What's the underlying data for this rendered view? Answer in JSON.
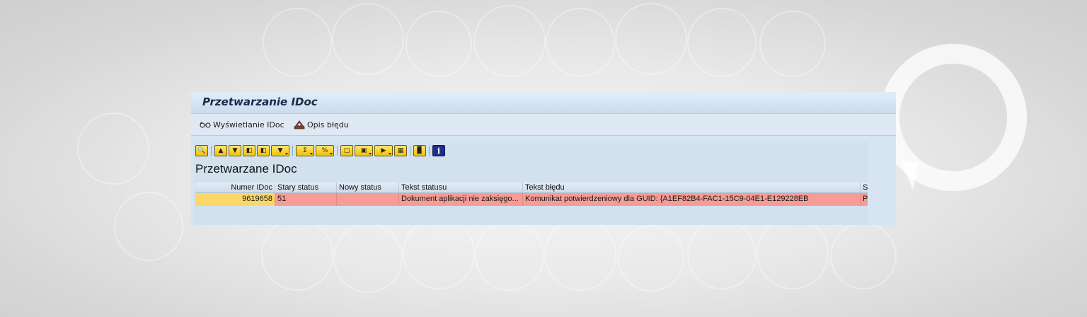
{
  "window": {
    "title": "Przetwarzanie IDoc"
  },
  "app_toolbar": {
    "buttons": [
      {
        "label": "Wyświetlanie IDoc",
        "icon": "glasses-icon"
      },
      {
        "label": "Opis błędu",
        "icon": "hat-icon"
      }
    ]
  },
  "alv_toolbar": {
    "icons": [
      "details-icon",
      "print-icon",
      "filter-icon",
      "find-icon",
      "find-next-icon",
      "set-filter-icon",
      "sum-icon",
      "subtotal-icon",
      "print-preview-icon",
      "views-icon",
      "export-icon",
      "layout-icon",
      "abc-analysis-icon",
      "info-icon"
    ]
  },
  "grid": {
    "title": "Przetwarzane IDoc",
    "columns": [
      "Numer IDoc",
      "Stary status",
      "Nowy status",
      "Tekst statusu",
      "Tekst błędu",
      "Sy"
    ],
    "rows": [
      {
        "numer_idoc": "9619658",
        "stary_status": "51",
        "nowy_status": "",
        "tekst_statusu": "Dokument aplikacji nie zaksięgo...",
        "tekst_bledu": "Komunikat potwierdzeniowy dla GUID: {A1EF82B4-FAC1-15C9-04E1-E129228EB",
        "sy": "PX"
      }
    ]
  },
  "colors": {
    "error_row": "#f59c95",
    "selected_cell": "#fbd76a",
    "title_bar": "#cbdcee",
    "button_yellow": "#f2c200"
  }
}
